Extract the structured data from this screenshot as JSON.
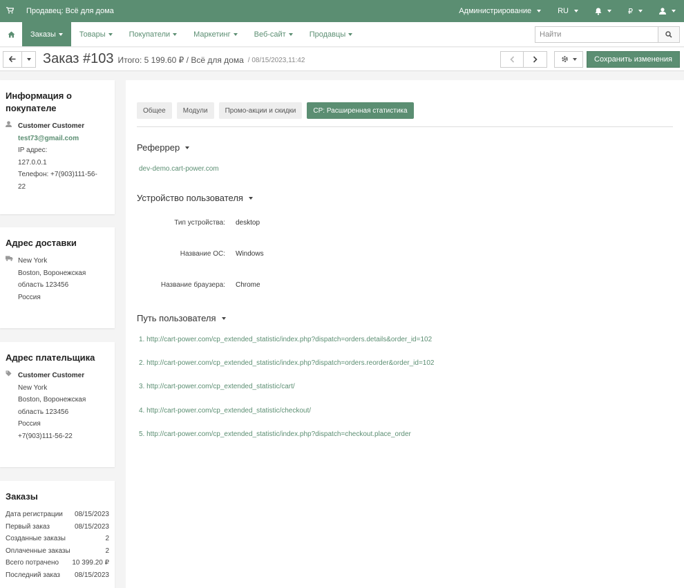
{
  "topbar": {
    "vendor": "Продавец: Всё для дома",
    "admin": "Администрирование",
    "lang": "RU",
    "currency": "₽"
  },
  "nav": {
    "items": [
      "Заказы",
      "Товары",
      "Покупатели",
      "Маркетинг",
      "Веб-сайт",
      "Продавцы"
    ],
    "search_placeholder": "Найти"
  },
  "title": {
    "order": "Заказ #103",
    "total": "Итого: 5 199.60 ₽ / Всё для дома",
    "date": "/ 08/15/2023,11:42",
    "save": "Сохранить изменения"
  },
  "customer": {
    "heading": "Информация о покупателе",
    "name": "Customer Customer",
    "email": "test73@gmail.com",
    "ip_label": "IP адрес:",
    "ip": "127.0.0.1",
    "phone_line1": "Телефон: +7(903)111-56-",
    "phone_line2": "22"
  },
  "shipping": {
    "heading": "Адрес доставки",
    "lines": [
      "New York",
      "Boston, Воронежская",
      "область 123456",
      "Россия"
    ]
  },
  "billing": {
    "heading": "Адрес плательщика",
    "name": "Customer Customer",
    "lines": [
      "New York",
      "Boston, Воронежская",
      "область 123456",
      "Россия",
      "+7(903)111-56-22"
    ]
  },
  "orders": {
    "heading": "Заказы",
    "rows": [
      {
        "label": "Дата регистрации",
        "value": "08/15/2023"
      },
      {
        "label": "Первый заказ",
        "value": "08/15/2023"
      },
      {
        "label": "Созданные заказы",
        "value": "2"
      },
      {
        "label": "Оплаченные заказы",
        "value": "2"
      },
      {
        "label": "Всего потрачено",
        "value": "10 399.20 ₽"
      },
      {
        "label": "Последний заказ",
        "value": "08/15/2023"
      }
    ]
  },
  "tabs": [
    "Общее",
    "Модули",
    "Промо-акции и скидки",
    "CP: Расширенная статистика"
  ],
  "referrer": {
    "heading": "Реферрер",
    "value": "dev-demo.cart-power.com"
  },
  "device": {
    "heading": "Устройство пользователя",
    "rows": [
      {
        "label": "Тип устройства:",
        "value": "desktop"
      },
      {
        "label": "Название ОС:",
        "value": "Windows"
      },
      {
        "label": "Название браузера:",
        "value": "Chrome"
      }
    ]
  },
  "path": {
    "heading": "Путь пользователя",
    "items": [
      "1. http://cart-power.com/cp_extended_statistic/index.php?dispatch=orders.details&order_id=102",
      "2. http://cart-power.com/cp_extended_statistic/index.php?dispatch=orders.reorder&order_id=102",
      "3. http://cart-power.com/cp_extended_statistic/cart/",
      "4. http://cart-power.com/cp_extended_statistic/checkout/",
      "5. http://cart-power.com/cp_extended_statistic/index.php?dispatch=checkout.place_order"
    ]
  },
  "colors": {
    "accent": "#5b8e72"
  }
}
